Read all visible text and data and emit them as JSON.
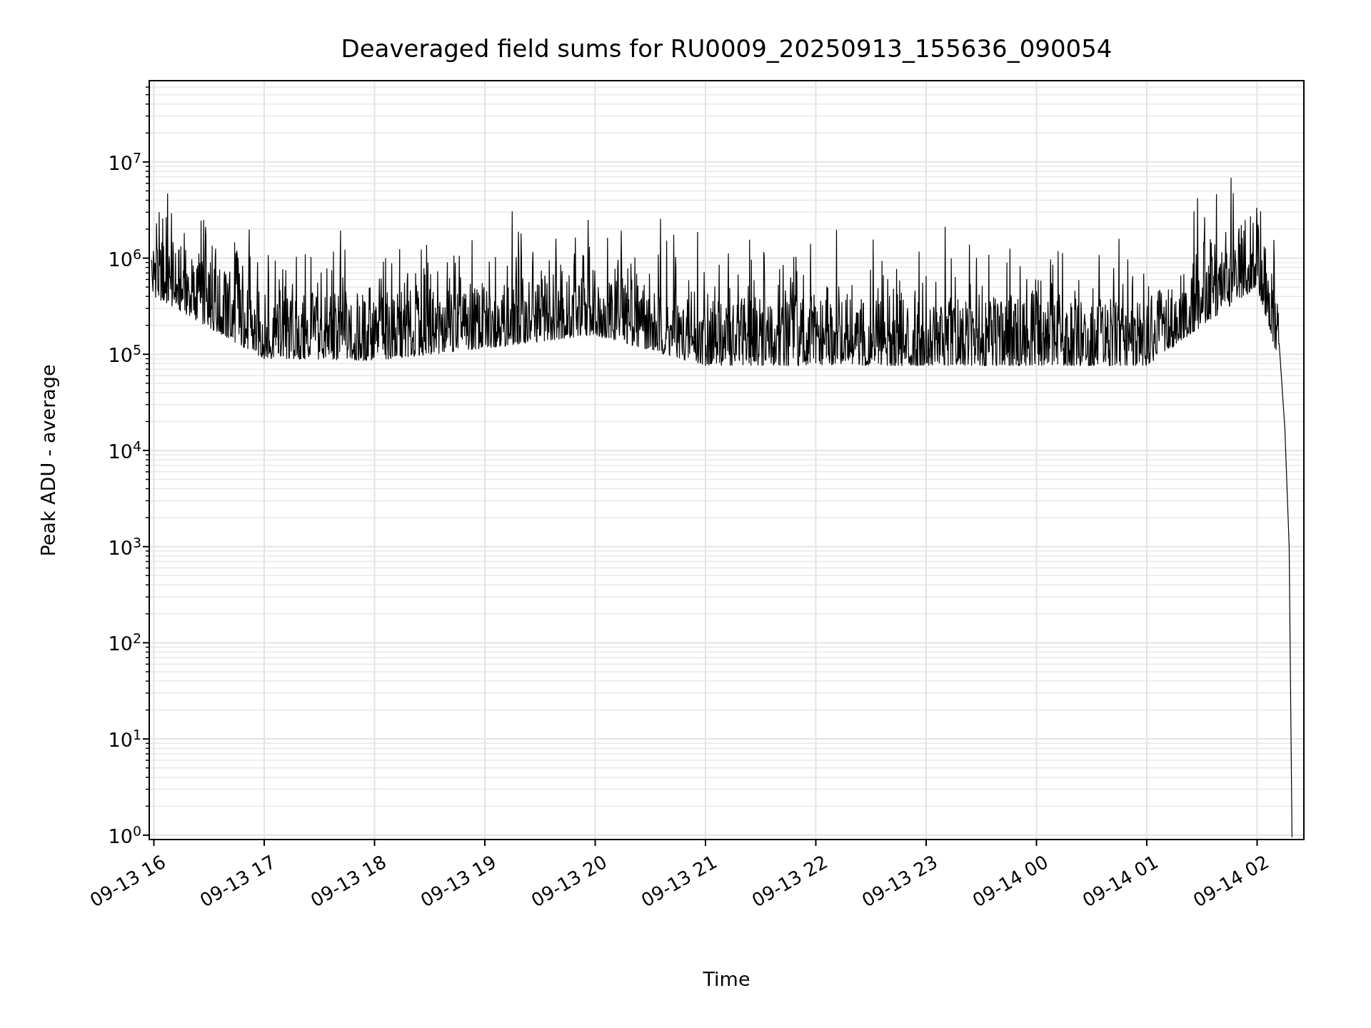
{
  "plot": {
    "title": "Deaveraged field sums for RU0009_20250913_155636_090054",
    "y_axis": {
      "label": "Peak ADU - average",
      "tick_labels": [
        "10$^{7}$",
        "10$^{6}$",
        "10$^{5}$",
        "10$^{4}$",
        "10$^{3}$",
        "10$^{2}$",
        "10$^{1}$",
        "10$^{0}$"
      ]
    },
    "x_axis": {
      "label": "Time",
      "tick_labels": [
        "09-13 16",
        "09-13 17",
        "09-13 18",
        "09-13 19",
        "09-13 20",
        "09-13 21",
        "09-13 22",
        "09-13 23",
        "09-14 00",
        "09-14 01",
        "09-14 02"
      ]
    }
  }
}
